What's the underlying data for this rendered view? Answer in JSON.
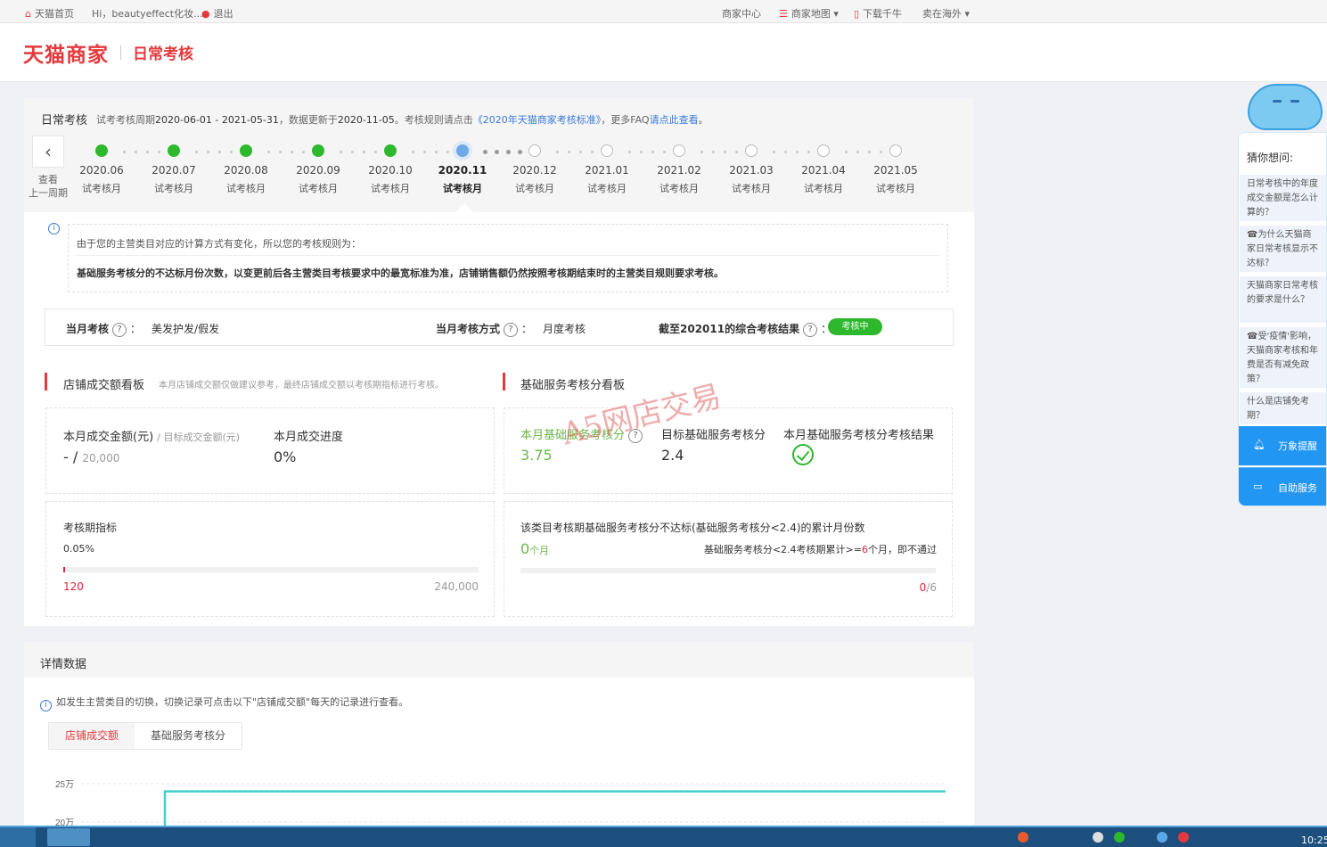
{
  "topbar": {
    "home": "天猫首页",
    "greeting": "Hi，beautyeffect化妆...",
    "logout": "退出",
    "merchant_center": "商家中心",
    "merchant_map": "商家地图",
    "download": "下载千牛",
    "sell_overseas": "卖在海外"
  },
  "header": {
    "logo": "天猫商家",
    "subtitle": "日常考核"
  },
  "assessment": {
    "title": "日常考核",
    "desc_prefix": "试考考核周期",
    "period": "2020-06-01 - 2021-05-31",
    "desc_mid": "，数据更新于",
    "updated": "2020-11-05",
    "desc_rule": "。考核规则请点击",
    "rule_link": "《2020年天猫商家考核标准》",
    "faq_prefix": "，更多FAQ",
    "faq_link": "请点此查看",
    "faq_suffix": "。",
    "prev_label_1": "查看",
    "prev_label_2": "上一周期"
  },
  "timeline": [
    {
      "date": "2020.06",
      "label": "试考核月",
      "status": "done"
    },
    {
      "date": "2020.07",
      "label": "试考核月",
      "status": "done"
    },
    {
      "date": "2020.08",
      "label": "试考核月",
      "status": "done"
    },
    {
      "date": "2020.09",
      "label": "试考核月",
      "status": "done"
    },
    {
      "date": "2020.10",
      "label": "试考核月",
      "status": "done"
    },
    {
      "date": "2020.11",
      "label": "试考核月",
      "status": "current"
    },
    {
      "date": "2020.12",
      "label": "试考核月",
      "status": "todo"
    },
    {
      "date": "2021.01",
      "label": "试考核月",
      "status": "todo"
    },
    {
      "date": "2021.02",
      "label": "试考核月",
      "status": "todo"
    },
    {
      "date": "2021.03",
      "label": "试考核月",
      "status": "todo"
    },
    {
      "date": "2021.04",
      "label": "试考核月",
      "status": "todo"
    },
    {
      "date": "2021.05",
      "label": "试考核月",
      "status": "todo"
    }
  ],
  "notice": {
    "line1": "由于您的主营类目对应的计算方式有变化，所以您的考核规则为：",
    "line2": "基础服务考核分的不达标月份次数，以变更前后各主营类目考核要求中的最宽标准为准，店铺销售额仍然按照考核期结束时的主营类目规则要求考核。"
  },
  "status": {
    "month_label": "当月考核",
    "month_value": "美发护发/假发",
    "method_label": "当月考核方式",
    "method_value": "月度考核",
    "result_label": "截至202011的综合考核结果",
    "result_badge": "考核中"
  },
  "sales_board": {
    "title": "店铺成交额看板",
    "desc": "本月店铺成交额仅做建议参考，最终店铺成交额以考核期指标进行考核。",
    "amount_label": "本月成交金额(元)",
    "target_label": "/ 目标成交金额(元)",
    "amount_value": "- /",
    "target_value": "20,000",
    "progress_label": "本月成交进度",
    "progress_value": "0%",
    "period_label": "考核期指标",
    "period_pct": "0.05%",
    "period_progress": 0.0005,
    "period_current": "120",
    "period_target": "240,000"
  },
  "service_board": {
    "title": "基础服务考核分看板",
    "score_label": "本月基础服务考核分",
    "score_value": "3.75",
    "target_label": "目标基础服务考核分",
    "target_value": "2.4",
    "result_label": "本月基础服务考核分考核结果",
    "fail_label": "该类目考核期基础服务考核分不达标(基础服务考核分<2.4)的累计月份数",
    "fail_count": "0",
    "fail_unit": "个月",
    "rule_prefix": "基础服务考核分<2.4考核期累计>=",
    "rule_num": "6",
    "rule_suffix": "个月，即不通过",
    "fail_ratio_num": "0",
    "fail_ratio_den": "/6"
  },
  "watermark": "A5网店交易",
  "detail": {
    "title": "详情数据",
    "note": "如发生主营类目的切换，切换记录可点击以下\"店铺成交额\"每天的记录进行查看。",
    "tab_active": "店铺成交额",
    "tab_inactive": "基础服务考核分"
  },
  "chart_data": {
    "type": "line",
    "y_ticks": [
      "25万",
      "20万"
    ],
    "series": [
      {
        "values": [
          0,
          240000,
          240000
        ]
      }
    ],
    "ylim": [
      0,
      250000
    ],
    "color": "#3fd1c8"
  },
  "help": {
    "title": "猜你想问:",
    "questions": [
      "日常考核中的年度成交金额是怎么计算的？",
      "☎为什么天猫商家日常考核显示不达标？",
      "天猫商家日常考核的要求是什么？",
      "☎受'疫情'影响，天猫商家考核和年费是否有减免政策？",
      "什么是店铺免考期？"
    ],
    "btn1": "万象提醒",
    "btn2": "自助服务"
  },
  "taskbar": {
    "clock": "10:25"
  }
}
